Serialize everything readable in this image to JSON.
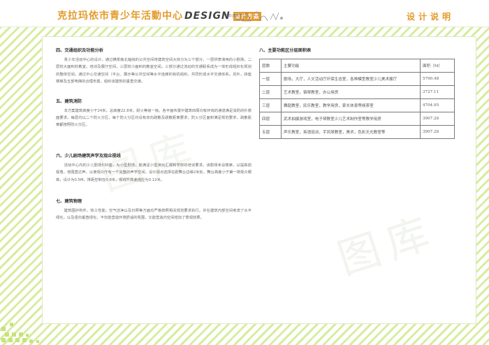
{
  "header": {
    "brand_cn": "克拉玛依市青少年活動中心",
    "brand_design": "DESIGN",
    "brand_badge": "设计方案",
    "brand_sub": "PROJECT",
    "title": "设计说明",
    "accent_color": "#e49a2a",
    "stripe_color": "#d7ec9f"
  },
  "left": {
    "sec4": {
      "title": "四、交通组织及功能分析",
      "para": "青少年活动中心的设计，通过横贯南北轴线的公共空间将建筑空间大体分为三个部分，一层供表演用的小剧场，二层较大面积的教室，培训及展厅空间，三层较小面积的教室空间。三部分通过流动的交通联系成为一体形成组织化规划的整体空间。通过中心交通空间（平台、展示等公共空间等水平连廊的有机组织，共同形成水平交通体系。另外，四座楼梯及五部电梯的合理布置，组织该建筑的垂直交通。"
    },
    "sec5": {
      "title": "五、建筑消防",
      "para": "本方案建筑高度小于24米，总高度22.8米，耐火等级一级。各平面布置中建筑四周均有环线的通道满足消防的扑救面要求。每层均以二个防火分区，每个防火分区均设有双向疏散及疏散距离要求，防火分区面积满足规范要求，疏散距离都按照防火分区。"
    },
    "sec6": {
      "title": "六、少儿剧场建筑声学及观众视线",
      "para": "活动中心内的少儿剧场530座，为小型剧场，能满足小型演出汇报和学校的培训要求。该剧场未设楼席，以提高前视角，增强直达声，以使观众厅有一个完整的声学空间。设计视点选择在距舞台边缘2米处，舞台高度小于第一排观众眼高，设计为0.5M。排距控制在0.9米，视线升高差值应为0.12米。"
    },
    "sec7": {
      "title": "七、建筑物理",
      "para": "建筑围护构件，热工性能，空气洁净以及日照等方面均严格按照相关规范要求执行。并在建筑内部空间考虑了水平绿化，以及竖向垂直绿化，不仅能营造环境舒适的氛围，又能营造内空间增加了景观效果。"
    }
  },
  "right": {
    "title": "八、主要功能区分层面积表",
    "table": {
      "header": [
        "层数",
        "主要功能",
        "面积（M）"
      ],
      "rows": [
        [
          "一层",
          "剧场，大厅，人文活动厅环保生态室，各种模型教室少儿美术展厅",
          "5790.48"
        ],
        [
          "二层",
          "艺术教室，钢琴教室，办公用房",
          "3727.11"
        ],
        [
          "三层",
          "舞蹈教室，民乐教室，教学用房，家长休息等候茶室",
          "4704.95"
        ],
        [
          "四层",
          "武术拍摄游戏室，电子琴教室少儿艺术制作室等教学用房",
          "3907.28"
        ],
        [
          "五层",
          "声乐教室，英语培训，手风琴教室，美术，色彩天光教室等",
          "3907.28"
        ]
      ]
    }
  }
}
